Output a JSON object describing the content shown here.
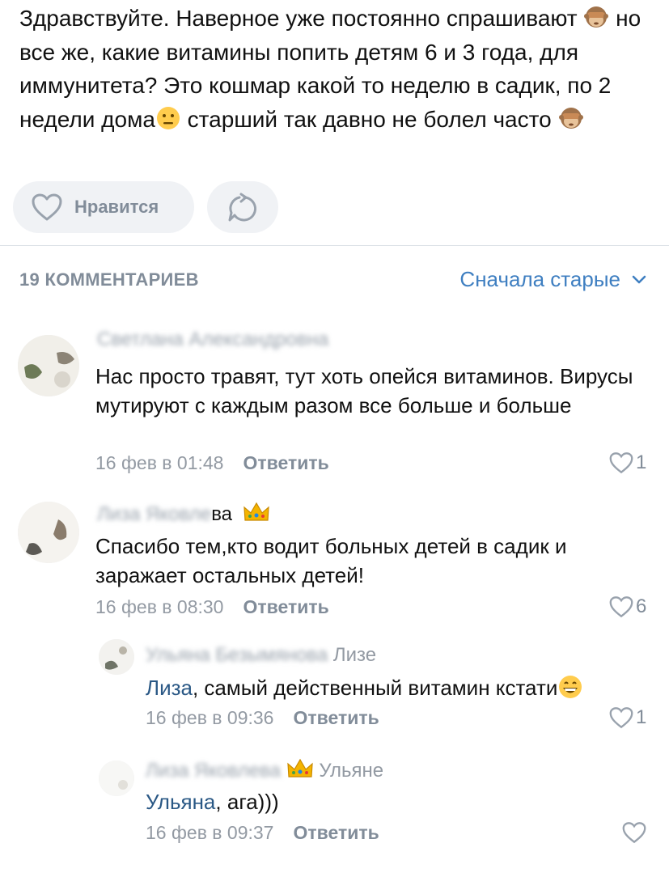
{
  "post": {
    "text_parts": {
      "p1": "Здравствуйте. Наверное уже постоянно спрашивают ",
      "p2": " но все же, какие витамины попить детям 6 и 3 года, для иммунитета? Это кошмар какой то неделю в садик, по 2 недели дома",
      "p3": " старший так давно не болел часто "
    },
    "emojis": [
      "see-no-evil-monkey",
      "neutral-face",
      "see-no-evil-monkey"
    ]
  },
  "actions": {
    "like_label": "Нравится"
  },
  "comments_header": {
    "count_label": "19 КОММЕНТАРИЕВ",
    "sort_label": "Сначала старые"
  },
  "comments": [
    {
      "author": "Светлана Александровна",
      "text": "Нас просто травят, тут хоть опейся витаминов. Вирусы мутируют с каждым разом все больше и больше",
      "date": "16 фев в 01:48",
      "reply_label": "Ответить",
      "likes": "1"
    },
    {
      "author_blur": "Лиза Яковле",
      "author_tail": "ва",
      "text": "Спасибо тем,кто водит больных детей в садик и заражает остальных детей!",
      "date": "16 фев в 08:30",
      "reply_label": "Ответить",
      "likes": "6"
    },
    {
      "author_blur": "Ульяна Безымянова",
      "reply_to": "Лизе",
      "mention": "Лиза",
      "text": ", самый действенный витамин кстати",
      "date": "16 фев в 09:36",
      "reply_label": "Ответить",
      "likes": "1"
    },
    {
      "author_blur": "Лиза Яковлева",
      "reply_to": "Ульяне",
      "mention": "Ульяна",
      "text": ", ага)))",
      "date": "16 фев в 09:37",
      "reply_label": "Ответить",
      "likes": ""
    }
  ],
  "colors": {
    "link": "#2a5885",
    "secondary": "#818c99",
    "pill_bg": "#f0f2f5"
  }
}
